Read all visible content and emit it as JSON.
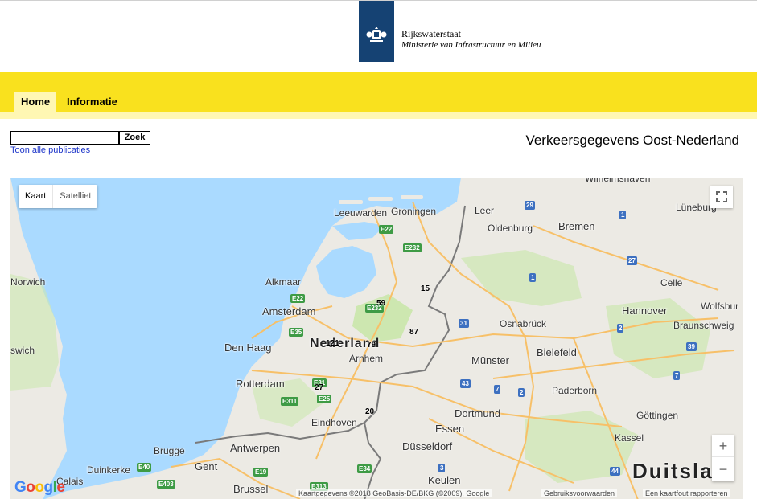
{
  "header": {
    "org_name": "Rijkswaterstaat",
    "ministry": "Ministerie van Infrastructuur en Milieu"
  },
  "nav": {
    "tabs": [
      {
        "label": "Home",
        "active": true
      },
      {
        "label": "Informatie",
        "active": false
      }
    ]
  },
  "search": {
    "value": "",
    "button_label": "Zoek",
    "all_publications_link": "Toon alle publicaties"
  },
  "page_title": "Verkeersgegevens Oost-Nederland",
  "map": {
    "map_type_buttons": [
      {
        "label": "Kaart",
        "active": true
      },
      {
        "label": "Satelliet",
        "active": false
      }
    ],
    "zoom_in": "+",
    "zoom_out": "−",
    "attribution": "Kaartgegevens ©2018 GeoBasis-DE/BKG (©2009), Google",
    "terms": "Gebruiksvoorwaarden",
    "report": "Een kaartfout rapporteren",
    "google_logo": [
      "G",
      "o",
      "o",
      "g",
      "l",
      "e"
    ],
    "cities": {
      "wilhelmshaven": "Wilhelmshaven",
      "leeuwarden": "Leeuwarden",
      "groningen": "Groningen",
      "leer": "Leer",
      "bremen": "Bremen",
      "luneburg": "Lüneburg",
      "oldenburg": "Oldenburg",
      "norwich": "Norwich",
      "alkmaar": "Alkmaar",
      "celle": "Celle",
      "amsterdam": "Amsterdam",
      "hannover": "Hannover",
      "wolfsburg": "Wolfsbur",
      "osnabruck": "Osnabrück",
      "braunschweig": "Braunschweig",
      "ipswich": "swich",
      "den_haag": "Den Haag",
      "nederland": "Nederland",
      "arnhem": "Arnhem",
      "bielefeld": "Bielefeld",
      "munster": "Münster",
      "rotterdam": "Rotterdam",
      "paderborn": "Paderborn",
      "dortmund": "Dortmund",
      "eindhoven": "Eindhoven",
      "gottingen": "Göttingen",
      "essen": "Essen",
      "brugge": "Brugge",
      "antwerpen": "Antwerpen",
      "dusseldorf": "Düsseldorf",
      "kassel": "Kassel",
      "dunkerque": "Duinkerke",
      "gent": "Gent",
      "keulen": "Keulen",
      "calais": "Calais",
      "brussel": "Brussel",
      "duitsland": "Duitslan"
    },
    "road_shields": {
      "e22a": "E22",
      "e232a": "E232",
      "e22b": "E22",
      "e232b": "E232",
      "e35": "E35",
      "e31": "E31",
      "e311": "E311",
      "e25": "E25",
      "e19": "E19",
      "e40": "E40",
      "e403": "E403",
      "e313": "E313",
      "e34": "E34",
      "a29": "29",
      "a1a": "1",
      "a1b": "1",
      "a27": "27",
      "a31": "31",
      "a2a": "2",
      "a2b": "2",
      "a43": "43",
      "a39": "39",
      "a7a": "7",
      "a7b": "7",
      "a30": "30",
      "a33": "33",
      "a44": "44",
      "a3": "3",
      "a7c": "7"
    },
    "counts": {
      "c15": "15",
      "c59": "59",
      "c87": "87",
      "c121": "121",
      "c79": "79",
      "c27": "27",
      "c20": "20"
    },
    "colors": {
      "water": "#aadaff",
      "land": "#eceae4",
      "green": "#cde7b0",
      "border": "#7a7a7a",
      "motorway": "#f7c068",
      "e_shield": "#3e9b45",
      "a_shield": "#3d70c0"
    }
  }
}
